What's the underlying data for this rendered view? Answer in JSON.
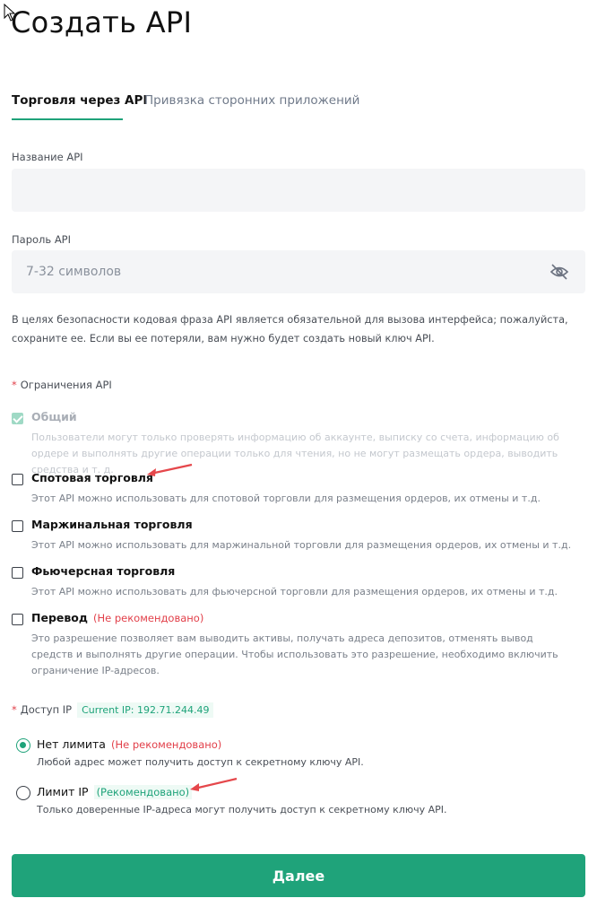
{
  "title": "Создать API",
  "tabs": [
    {
      "label": "Торговля через API",
      "active": true
    },
    {
      "label": "Привязка сторонних приложений",
      "active": false
    }
  ],
  "api_name": {
    "label": "Название API",
    "value": "",
    "placeholder": ""
  },
  "api_password": {
    "label": "Пароль API",
    "value": "",
    "placeholder": "7-32 символов",
    "icon": "eye-off-icon"
  },
  "notice": "В целях безопасности кодовая фраза API является обязательной для вызова интерфейса; пожалуйста, сохраните ее. Если вы ее потеряли, вам нужно будет создать новый ключ API.",
  "restrictions": {
    "required_mark": "*",
    "label": "Ограничения API",
    "items": [
      {
        "title": "Общий",
        "checked": true,
        "disabled": true,
        "badge": "",
        "desc": "Пользователи могут только проверять информацию об аккаунте, выписку со счета, информацию об ордере и выполнять другие операции только для чтения, но не могут размещать ордера, выводить средства и т. д."
      },
      {
        "title": "Спотовая торговля",
        "checked": false,
        "disabled": false,
        "badge": "",
        "desc": "Этот API можно использовать для спотовой торговли для размещения ордеров, их отмены и т.д."
      },
      {
        "title": "Маржинальная торговля",
        "checked": false,
        "disabled": false,
        "badge": "",
        "desc": "Этот API можно использовать для маржинальной торговли для размещения ордеров, их отмены и т.д."
      },
      {
        "title": "Фьючерсная торговля",
        "checked": false,
        "disabled": false,
        "badge": "",
        "desc": "Этот API можно использовать для фьючерсной торговли для размещения ордеров, их отмены и т.д."
      },
      {
        "title": "Перевод",
        "checked": false,
        "disabled": false,
        "badge": "(Не рекомендовано)",
        "desc": "Это разрешение позволяет вам выводить активы, получать адреса депозитов, отменять вывод средств и выполнять другие операции. Чтобы использовать это разрешение, необходимо включить ограничение IP-адресов."
      }
    ]
  },
  "ip_access": {
    "required_mark": "*",
    "label": "Доступ IP",
    "current_ip": "Current IP:   192.71.244.49",
    "options": [
      {
        "title": "Нет лимита",
        "badge": "(Не рекомендовано)",
        "selected": true,
        "desc": "Любой адрес может получить доступ к секретному ключу API."
      },
      {
        "title": "Лимит IP",
        "badge": "(Рекомендовано)",
        "selected": false,
        "desc": "Только доверенные IP-адреса могут получить доступ к секретному ключу API."
      }
    ]
  },
  "submit_label": "Далее",
  "colors": {
    "accent": "#1fa37a",
    "warning": "#e2404a",
    "annotation_arrow": "#e5474b"
  }
}
